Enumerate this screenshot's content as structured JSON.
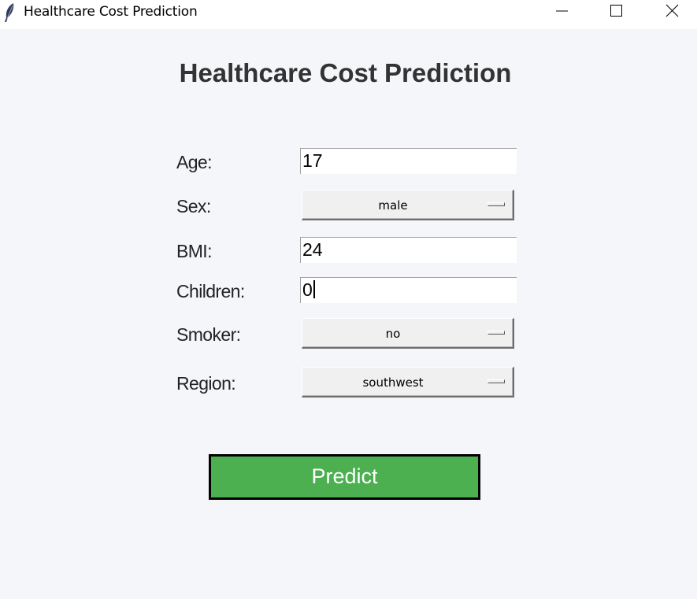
{
  "window": {
    "title": "Healthcare Cost Prediction",
    "icon": "feather-icon"
  },
  "heading": "Healthcare Cost Prediction",
  "form": {
    "age": {
      "label": "Age:",
      "value": "17"
    },
    "sex": {
      "label": "Sex:",
      "value": "male"
    },
    "bmi": {
      "label": "BMI:",
      "value": "24"
    },
    "children": {
      "label": "Children:",
      "value": "0"
    },
    "smoker": {
      "label": "Smoker:",
      "value": "no"
    },
    "region": {
      "label": "Region:",
      "value": "southwest"
    }
  },
  "predict_button": {
    "label": "Predict",
    "color": "#4caf50"
  }
}
